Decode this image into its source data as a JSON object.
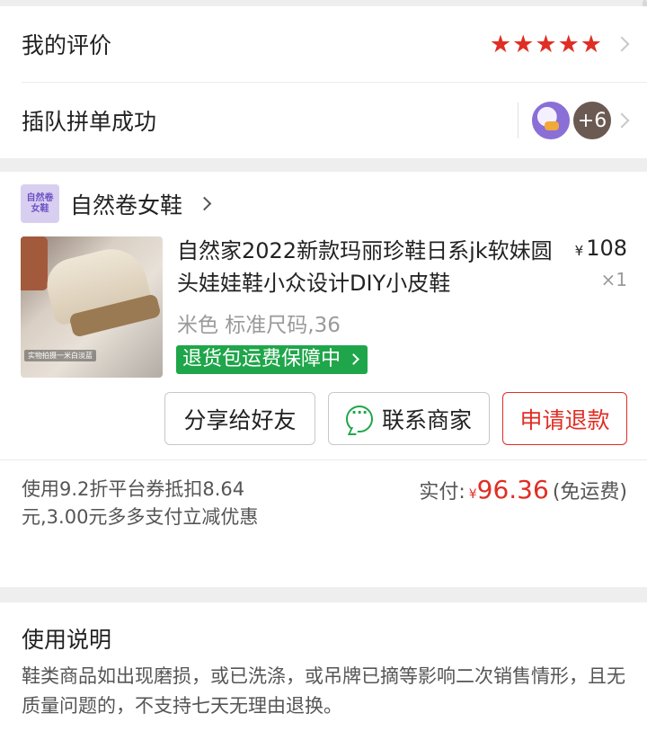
{
  "review": {
    "label": "我的评价",
    "stars": 5,
    "star_color": "#e02e24"
  },
  "group": {
    "label": "插队拼单成功",
    "extra_count": "+6"
  },
  "store": {
    "logo_text": "自然卷女鞋",
    "name": "自然卷女鞋"
  },
  "product": {
    "title": "自然家2022新款玛丽珍鞋日系jk软妹圆头娃娃鞋小众设计DIY小皮鞋",
    "currency": "¥",
    "price": "108",
    "quantity": "×1",
    "spec": "米色 标准尺码,36",
    "guarantee": "退货包运费保障中",
    "image_caption": "实物拍摄一米白淡蓝"
  },
  "actions": {
    "share": "分享给好友",
    "contact": "联系商家",
    "refund": "申请退款"
  },
  "payment": {
    "discount_text": "使用9.2折平台券抵扣8.64元,3.00元多多支付立减优惠",
    "paid_label": "实付:",
    "currency": "¥",
    "amount": "96.36",
    "shipping": "(免运费)",
    "accent": "#e02e24"
  },
  "usage": {
    "title": "使用说明",
    "text": "鞋类商品如出现磨损，或已洗涤，或吊牌已摘等影响二次销售情形，且无质量问题的，不支持七天无理由退换。"
  },
  "colors": {
    "green": "#1fa64a",
    "red": "#e02e24",
    "background": "#eeeeee"
  }
}
